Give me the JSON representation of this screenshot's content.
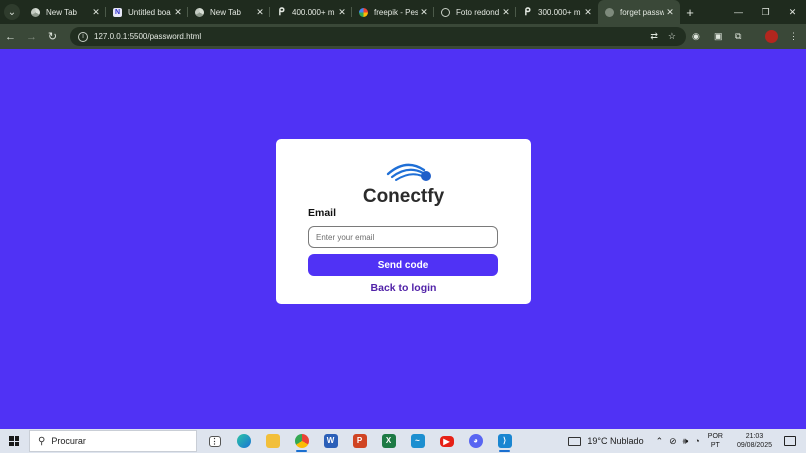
{
  "browser": {
    "tabs": [
      {
        "title": "New Tab",
        "favicon": "chrome-icon"
      },
      {
        "title": "Untitled boa",
        "favicon": "untitled-board-icon"
      },
      {
        "title": "New Tab",
        "favicon": "chrome-icon"
      },
      {
        "title": "400.000+ m",
        "favicon": "p-icon"
      },
      {
        "title": "freepik - Pes",
        "favicon": "google-icon"
      },
      {
        "title": "Foto redond",
        "favicon": "globe-icon"
      },
      {
        "title": "300.000+ m",
        "favicon": "p-icon"
      },
      {
        "title": "forget passw",
        "favicon": "page-icon",
        "active": true
      }
    ],
    "url": "127.0.0.1:5500/password.html"
  },
  "page": {
    "brand_name": "Conectfy",
    "email_label": "Email",
    "email_placeholder": "Enter your email",
    "email_value": "",
    "send_button": "Send code",
    "back_link": "Back to login",
    "accent_color": "#5032f5",
    "link_color": "#5122a8"
  },
  "taskbar": {
    "search_placeholder": "Procurar",
    "weather_temp": "19°C",
    "weather_desc": "Nublado",
    "lang_1": "POR",
    "lang_2": "PT",
    "time": "21:03",
    "date": "09/08/2025"
  }
}
